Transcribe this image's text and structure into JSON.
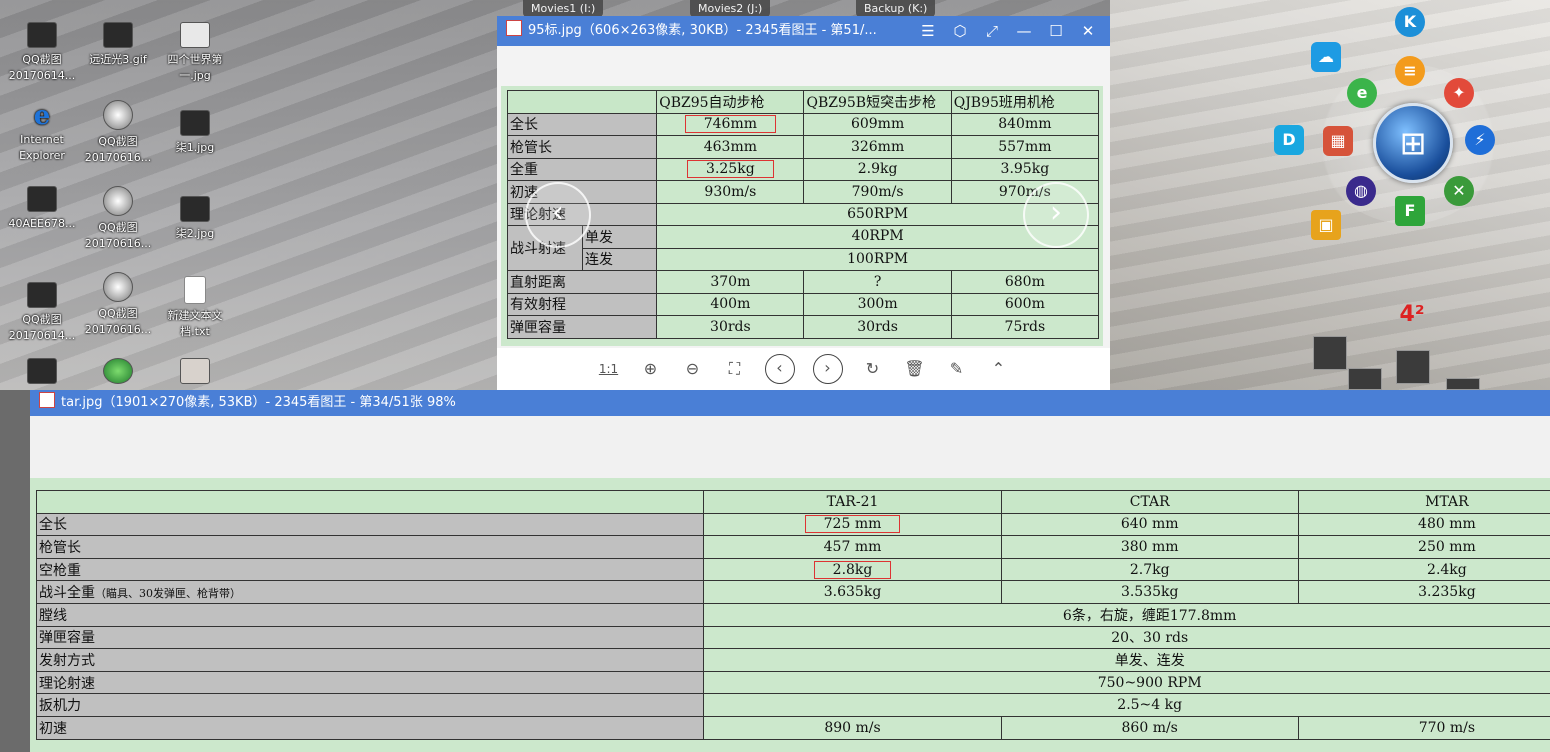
{
  "drives": [
    "Movies1 (I:)",
    "Movies2 (J:)",
    "Backup (K:)"
  ],
  "desktop_icons": [
    {
      "label": "QQ截图\n20170614...",
      "kind": "thumb"
    },
    {
      "label": "远近光3.gif",
      "kind": "thumb"
    },
    {
      "label": "四个世界第一.jpg",
      "kind": "thumb"
    },
    {
      "label": "Internet Explorer",
      "kind": "ie"
    },
    {
      "label": "QQ截图\n20170616...",
      "kind": "round"
    },
    {
      "label": "柒1.jpg",
      "kind": "thumb"
    },
    {
      "label": "40AEE678...",
      "kind": "thumb"
    },
    {
      "label": "QQ截图\n20170616...",
      "kind": "round"
    },
    {
      "label": "柒2.jpg",
      "kind": "thumb"
    },
    {
      "label": "QQ截图\n20170614...",
      "kind": "thumb"
    },
    {
      "label": "QQ截图\n20170616...",
      "kind": "round"
    },
    {
      "label": "新建文本文档.txt",
      "kind": "txt"
    }
  ],
  "window1": {
    "title": "95标.jpg（606×263像素, 30KB）- 2345看图王 - 第51/...",
    "table": {
      "headers": [
        "",
        "QBZ95自动步枪",
        "QBZ95B短突击步枪",
        "QJB95班用机枪"
      ],
      "rows": [
        {
          "label": "全长",
          "values": [
            "746mm",
            "609mm",
            "840mm"
          ]
        },
        {
          "label": "枪管长",
          "values": [
            "463mm",
            "326mm",
            "557mm"
          ]
        },
        {
          "label": "全重",
          "values": [
            "3.25kg",
            "2.9kg",
            "3.95kg"
          ]
        },
        {
          "label": "初速",
          "values": [
            "930m/s",
            "790m/s",
            "970m/s"
          ]
        }
      ],
      "theory_rate": {
        "label": "理论射速",
        "value": "650RPM"
      },
      "combat_rate": {
        "label": "战斗射速",
        "single_label": "单发",
        "single": "40RPM",
        "auto_label": "连发",
        "auto": "100RPM"
      },
      "rows2": [
        {
          "label": "直射距离",
          "values": [
            "370m",
            "?",
            "680m"
          ]
        },
        {
          "label": "有效射程",
          "values": [
            "400m",
            "300m",
            "600m"
          ]
        },
        {
          "label": "弹匣容量",
          "values": [
            "30rds",
            "30rds",
            "75rds"
          ]
        }
      ]
    },
    "toolbar": {
      "actual_size": "1:1"
    }
  },
  "window2": {
    "title": "tar.jpg（1901×270像素, 53KB）- 2345看图王 - 第34/51张 98%",
    "table": {
      "headers": [
        "",
        "TAR-21",
        "CTAR",
        "MTAR"
      ],
      "rows": [
        {
          "label": "全长",
          "values": [
            "725 mm",
            "640 mm",
            "480 mm"
          ]
        },
        {
          "label": "枪管长",
          "values": [
            "457 mm",
            "380 mm",
            "250 mm"
          ]
        },
        {
          "label": "空枪重",
          "values": [
            "2.8kg",
            "2.7kg",
            "2.4kg"
          ]
        }
      ],
      "combat_weight": {
        "label": "战斗全重",
        "note": "（瞄具、30发弹匣、枪背带）",
        "values": [
          "3.635kg",
          "3.535kg",
          "3.235kg"
        ]
      },
      "spans": [
        {
          "label": "膛线",
          "value": "6条，右旋，缠距177.8mm"
        },
        {
          "label": "弹匣容量",
          "value": "20、30 rds"
        },
        {
          "label": "发射方式",
          "value": "单发、连发"
        },
        {
          "label": "理论射速",
          "value": "750~900 RPM"
        },
        {
          "label": "扳机力",
          "value": "2.5~4 kg"
        }
      ],
      "velocity": {
        "label": "初速",
        "values": [
          "890 m/s",
          "860 m/s",
          "770 m/s"
        ]
      }
    }
  }
}
